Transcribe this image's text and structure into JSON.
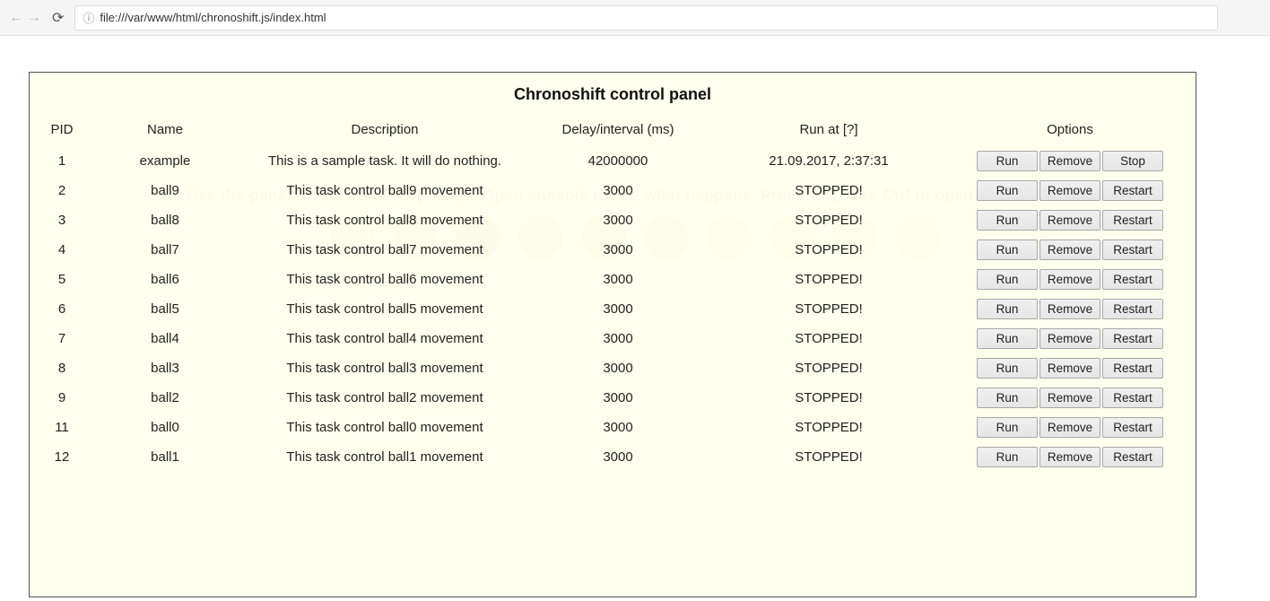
{
  "browser": {
    "url": "file:///var/www/html/chronoshift.js/index.html"
  },
  "hint": "Use the panel to launch or stop tasks. Open console to see what happens. Press Ctrl, Ctrl, Ctrl to open control panel.",
  "panel": {
    "title": "Chronoshift control panel",
    "headers": {
      "pid": "PID",
      "name": "Name",
      "desc": "Description",
      "delay": "Delay/interval (ms)",
      "runat": "Run at [?]",
      "opts": "Options"
    },
    "buttons": {
      "run": "Run",
      "remove": "Remove",
      "stop": "Stop",
      "restart": "Restart"
    },
    "rows": [
      {
        "pid": "1",
        "name": "example",
        "desc": "This is a sample task. It will do nothing.",
        "delay": "42000000",
        "runat": "21.09.2017, 2:37:31",
        "third_btn": "stop"
      },
      {
        "pid": "2",
        "name": "ball9",
        "desc": "This task control ball9 movement",
        "delay": "3000",
        "runat": "STOPPED!",
        "third_btn": "restart"
      },
      {
        "pid": "3",
        "name": "ball8",
        "desc": "This task control ball8 movement",
        "delay": "3000",
        "runat": "STOPPED!",
        "third_btn": "restart"
      },
      {
        "pid": "4",
        "name": "ball7",
        "desc": "This task control ball7 movement",
        "delay": "3000",
        "runat": "STOPPED!",
        "third_btn": "restart"
      },
      {
        "pid": "5",
        "name": "ball6",
        "desc": "This task control ball6 movement",
        "delay": "3000",
        "runat": "STOPPED!",
        "third_btn": "restart"
      },
      {
        "pid": "6",
        "name": "ball5",
        "desc": "This task control ball5 movement",
        "delay": "3000",
        "runat": "STOPPED!",
        "third_btn": "restart"
      },
      {
        "pid": "7",
        "name": "ball4",
        "desc": "This task control ball4 movement",
        "delay": "3000",
        "runat": "STOPPED!",
        "third_btn": "restart"
      },
      {
        "pid": "8",
        "name": "ball3",
        "desc": "This task control ball3 movement",
        "delay": "3000",
        "runat": "STOPPED!",
        "third_btn": "restart"
      },
      {
        "pid": "9",
        "name": "ball2",
        "desc": "This task control ball2 movement",
        "delay": "3000",
        "runat": "STOPPED!",
        "third_btn": "restart"
      },
      {
        "pid": "11",
        "name": "ball0",
        "desc": "This task control ball0 movement",
        "delay": "3000",
        "runat": "STOPPED!",
        "third_btn": "restart"
      },
      {
        "pid": "12",
        "name": "ball1",
        "desc": "This task control ball1 movement",
        "delay": "3000",
        "runat": "STOPPED!",
        "third_btn": "restart"
      }
    ]
  }
}
